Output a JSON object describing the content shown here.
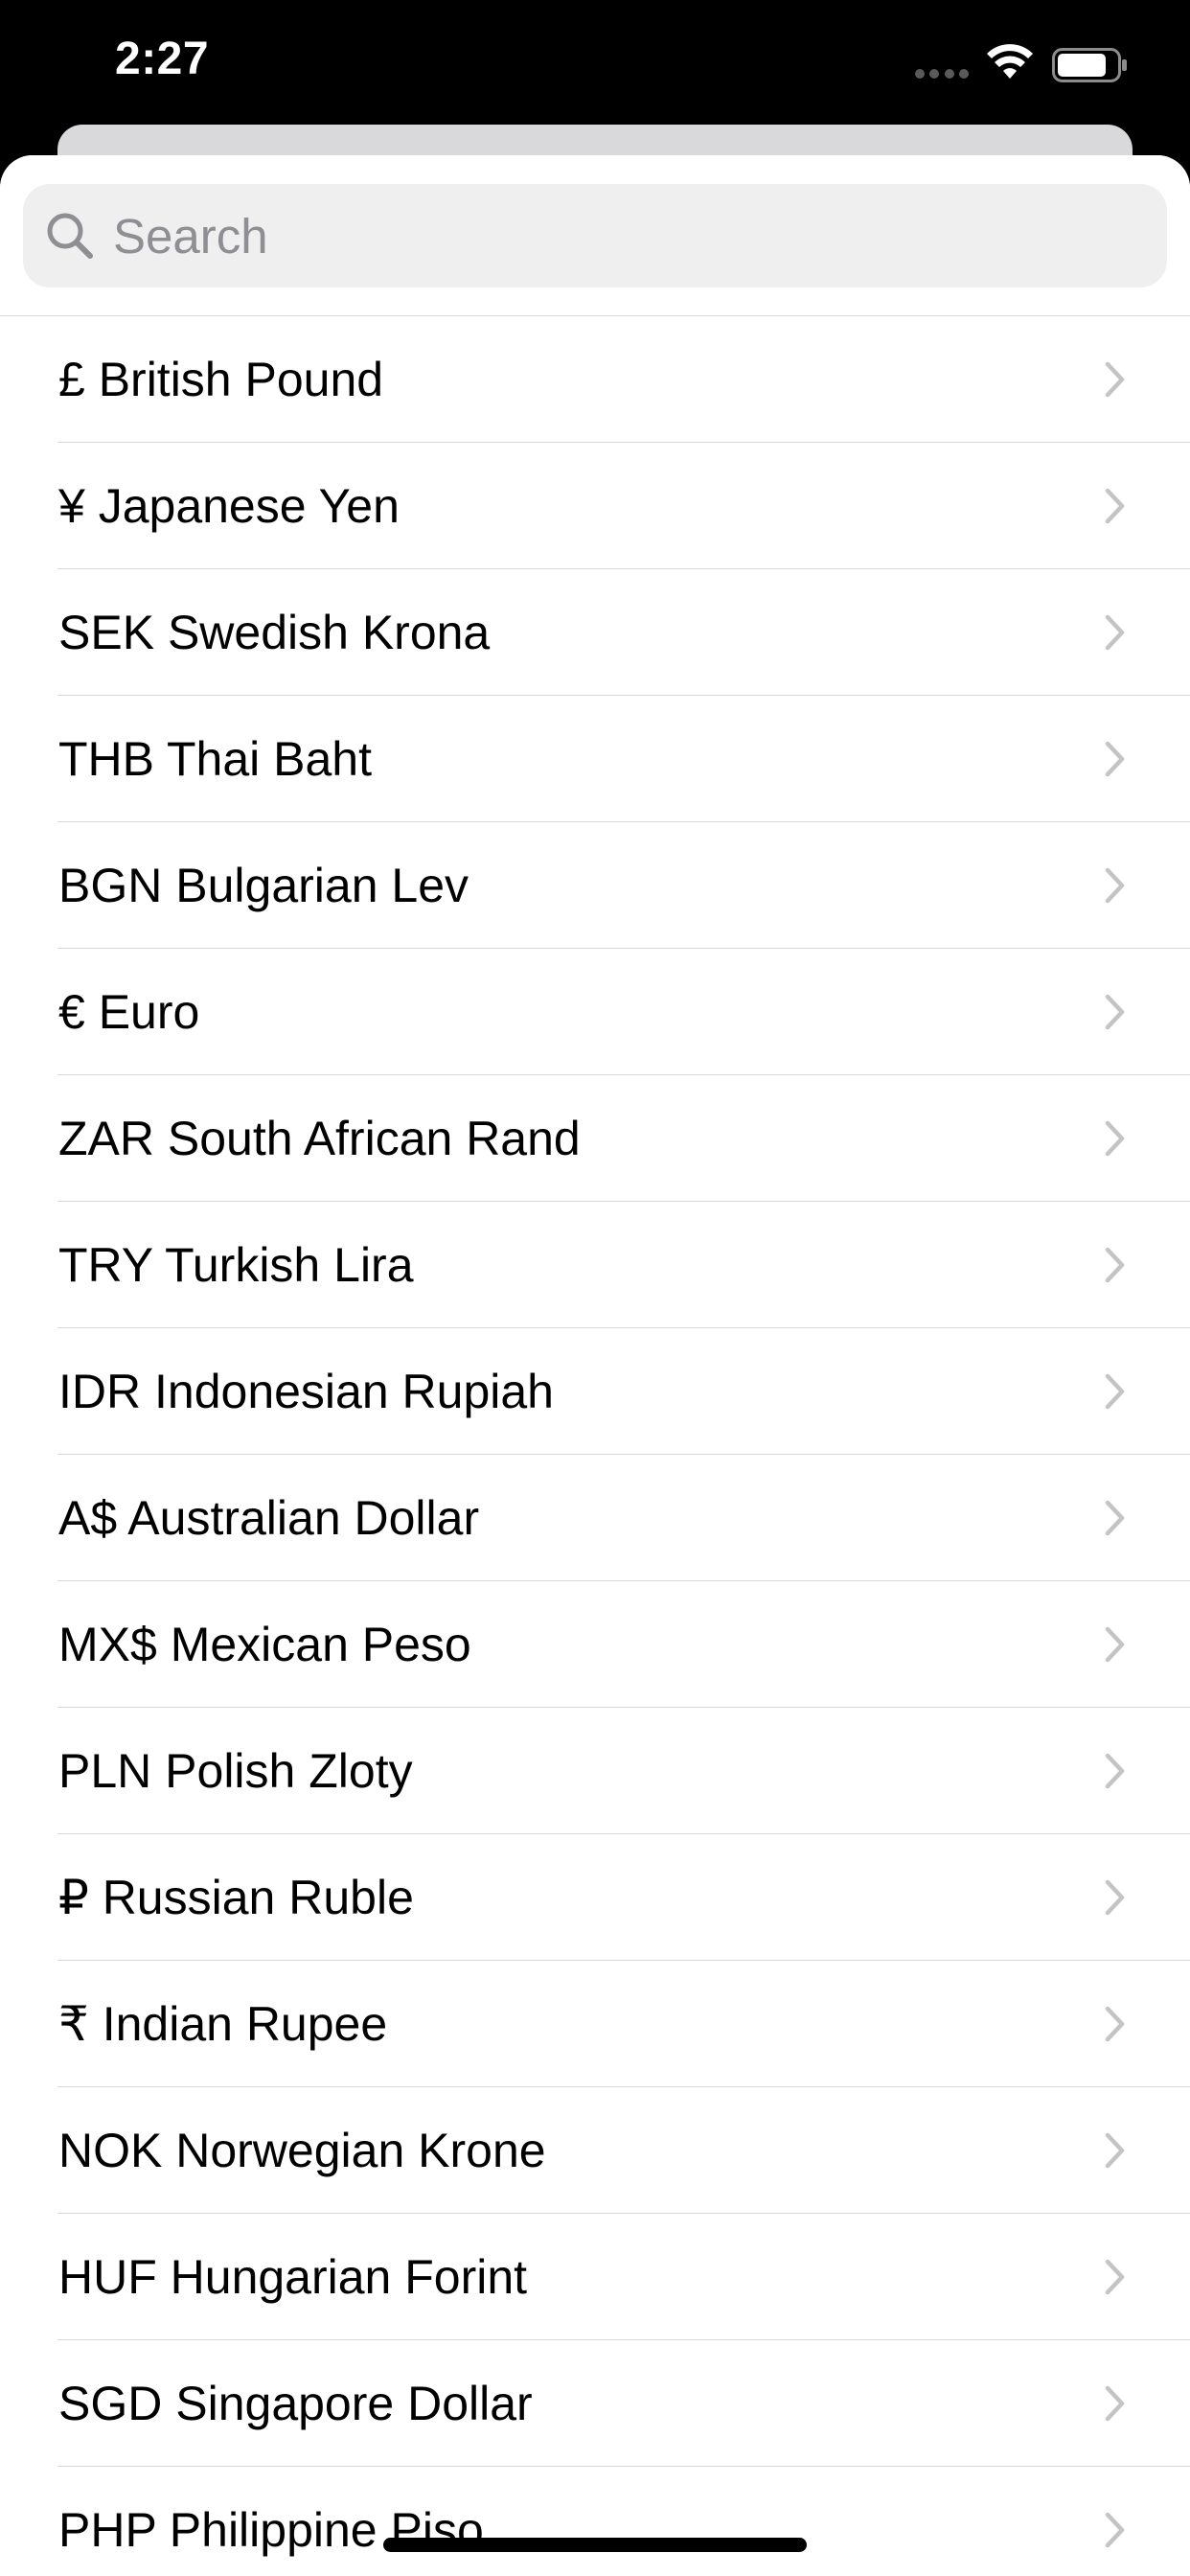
{
  "status_bar": {
    "time": "2:27",
    "signal_icon": "cellular-signal-icon",
    "wifi_icon": "wifi-icon",
    "battery_icon": "battery-icon"
  },
  "search": {
    "placeholder": "Search",
    "value": "",
    "icon": "magnifying-glass-icon"
  },
  "currencies": [
    {
      "label": "£ British Pound"
    },
    {
      "label": "¥ Japanese Yen"
    },
    {
      "label": "SEK Swedish Krona"
    },
    {
      "label": "THB Thai Baht"
    },
    {
      "label": "BGN Bulgarian Lev"
    },
    {
      "label": "€ Euro"
    },
    {
      "label": "ZAR South African Rand"
    },
    {
      "label": "TRY Turkish Lira"
    },
    {
      "label": "IDR Indonesian Rupiah"
    },
    {
      "label": "A$ Australian Dollar"
    },
    {
      "label": "MX$ Mexican Peso"
    },
    {
      "label": "PLN Polish Zloty"
    },
    {
      "label": "₽ Russian Ruble"
    },
    {
      "label": "₹ Indian Rupee"
    },
    {
      "label": "NOK Norwegian Krone"
    },
    {
      "label": "HUF Hungarian Forint"
    },
    {
      "label": "SGD Singapore Dollar"
    },
    {
      "label": "PHP Philippine Piso"
    }
  ],
  "colors": {
    "separator": "#d8d8dc",
    "search_bg": "#efeff0",
    "placeholder": "#8e8e93",
    "chevron": "#c4c4c7"
  }
}
